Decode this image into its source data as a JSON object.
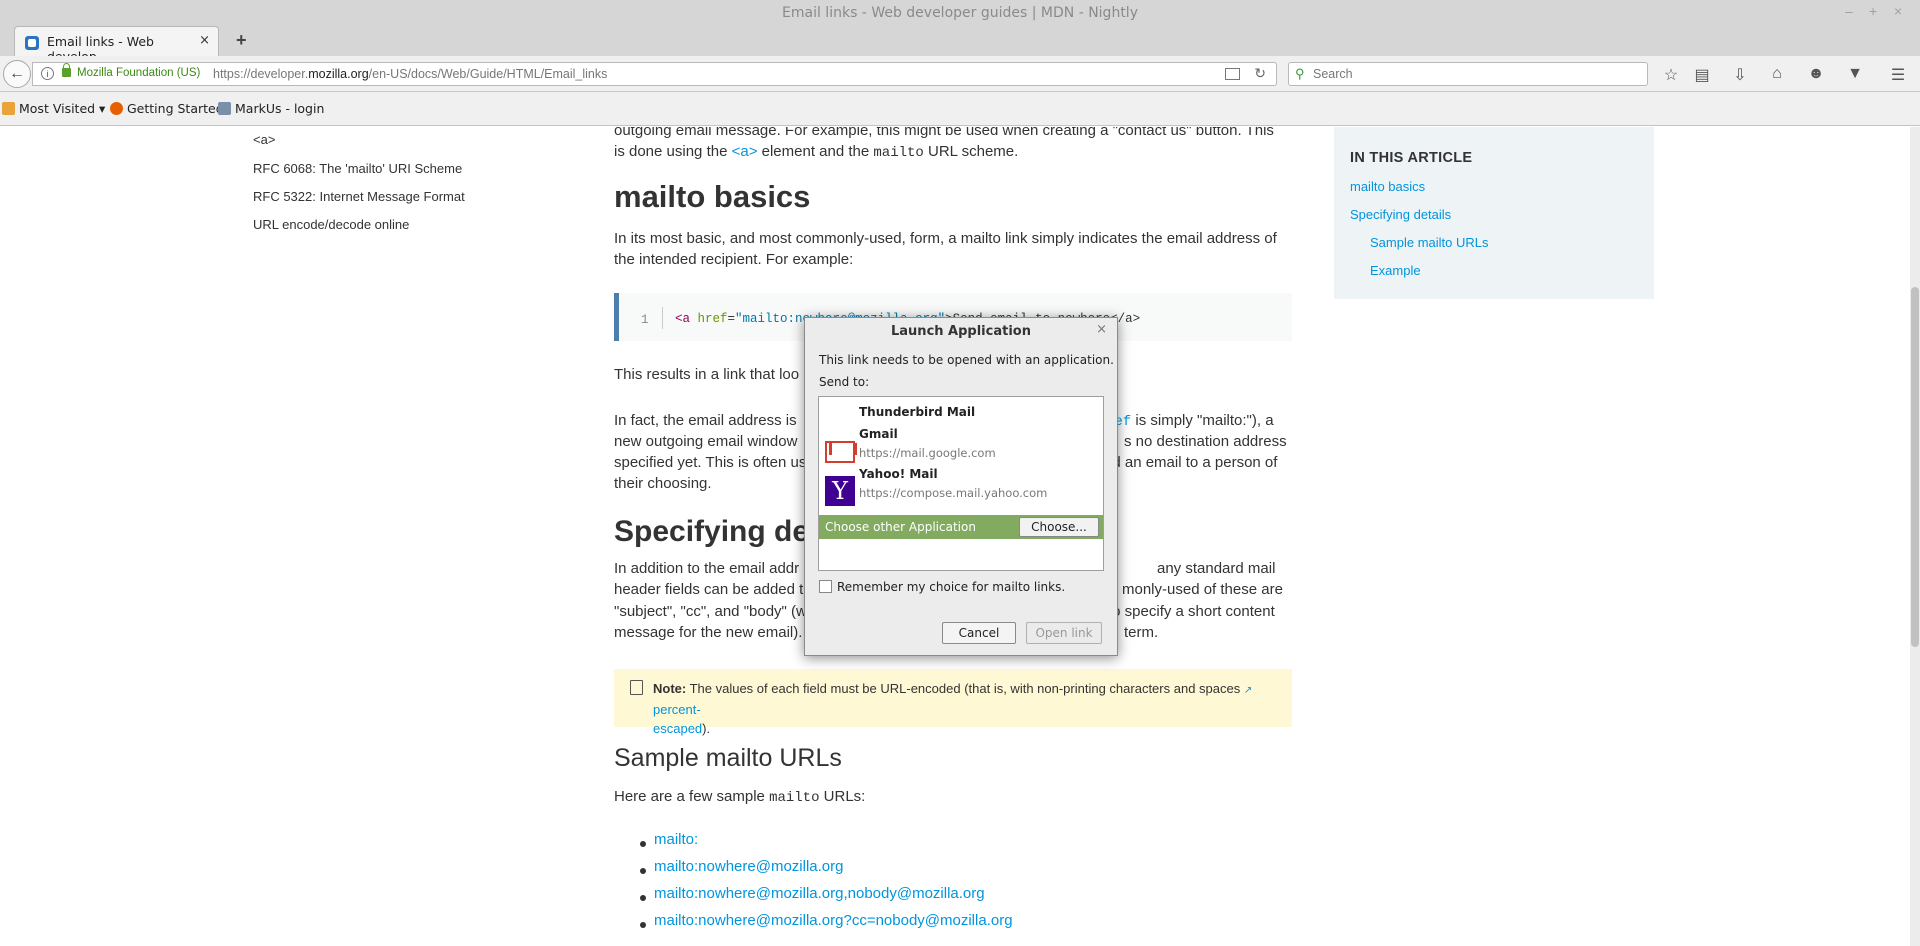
{
  "window": {
    "title": "Email links - Web developer guides | MDN - Nightly",
    "controls": [
      "–",
      "+",
      "×"
    ]
  },
  "tab": {
    "label": "Email links - Web develop...",
    "close": "×",
    "new_tab": "+"
  },
  "navbar": {
    "back": "←",
    "info": "i",
    "org": "Mozilla Foundation (US)",
    "url_pre": "https://developer.",
    "url_domain": "mozilla.org",
    "url_post": "/en-US/docs/Web/Guide/HTML/Email_links",
    "reload": "↻",
    "search_placeholder": "Search",
    "icons": [
      "star-icon",
      "reading-list-icon",
      "download-icon",
      "home-icon",
      "chat-icon",
      "pocket-icon",
      "menu-icon"
    ]
  },
  "bookmarks": {
    "most_visited": "Most Visited ▾",
    "getting_started": "Getting Started",
    "markus": "MarkUs - login"
  },
  "sidebar": {
    "links": [
      "<a>",
      "RFC 6068: The 'mailto' URI Scheme",
      "RFC 5322: Internet Message Format",
      "URL encode/decode online"
    ]
  },
  "toc": {
    "heading": "IN THIS ARTICLE",
    "items": [
      "mailto basics",
      "Specifying details",
      "Sample mailto URLs",
      "Example"
    ]
  },
  "article": {
    "intro_line1": "outgoing email message. For example, this might be used when creating a \"contact us\" button. This",
    "intro_line2_pre": "is done using the ",
    "intro_line2_a": "<a>",
    "intro_line2_mid": " element and the ",
    "intro_line2_code": "mailto",
    "intro_line2_post": " URL scheme.",
    "h_basics": "mailto basics",
    "basics_p1": "In its most basic, and most commonly-used, form, a mailto link simply indicates the email address of",
    "basics_p2": "the intended recipient. For example:",
    "code_line_no": "1",
    "code_tag": "<a",
    "code_attr": " href",
    "code_eq": "=",
    "code_val": "\"mailto:nowhere@mozilla.org\"",
    "code_rest": ">Send email to nowhere</a>",
    "results_line": "This results in a link that loo",
    "fact_l1_a": "In fact, the email address is ",
    "fact_l1_code": "ref",
    "fact_l1_b": " is simply \"mailto:\"), a",
    "fact_l2_a": "new outgoing email window",
    "fact_l2_b": "s no destination address",
    "fact_l3_a": "specified yet. This is often us",
    "fact_l3_b": "nd an email to a person of",
    "fact_l4": "their choosing.",
    "h_details": "Specifying det",
    "det_l1_a": "In addition to the email addr",
    "det_l1_b": "any standard mail",
    "det_l2_a": "header fields can be added t",
    "det_l2_b": "monly-used of these are",
    "det_l3_a": "\"subject\", \"cc\", and \"body\" (w",
    "det_l3_b": "to specify a short content",
    "det_l4_a": "message for the new email).",
    "det_l4_b": "term.",
    "note_label": "Note:",
    "note_text": " The values of each field must be URL-encoded (that is, with non-printing characters and spaces ",
    "note_link1": "percent-",
    "note_link2": "escaped",
    "note_end": ").",
    "h_samples": "Sample mailto URLs",
    "samples_intro_pre": "Here are a few sample ",
    "samples_intro_code": "mailto",
    "samples_intro_post": " URLs:",
    "samples": [
      "mailto:",
      "mailto:nowhere@mozilla.org",
      "mailto:nowhere@mozilla.org,nobody@mozilla.org",
      "mailto:nowhere@mozilla.org?cc=nobody@mozilla.org"
    ]
  },
  "dialog": {
    "title": "Launch Application",
    "close": "×",
    "message": "This link needs to be opened with an application.",
    "send_to": "Send to:",
    "apps": [
      {
        "name": "Thunderbird Mail",
        "url": ""
      },
      {
        "name": "Gmail",
        "url": "https://mail.google.com"
      },
      {
        "name": "Yahoo! Mail",
        "url": "https://compose.mail.yahoo.com"
      }
    ],
    "yahoo_glyph": "Y",
    "choose_other": "Choose other Application",
    "choose_button": "Choose...",
    "remember": "Remember my choice for mailto links.",
    "cancel": "Cancel",
    "open": "Open link"
  }
}
